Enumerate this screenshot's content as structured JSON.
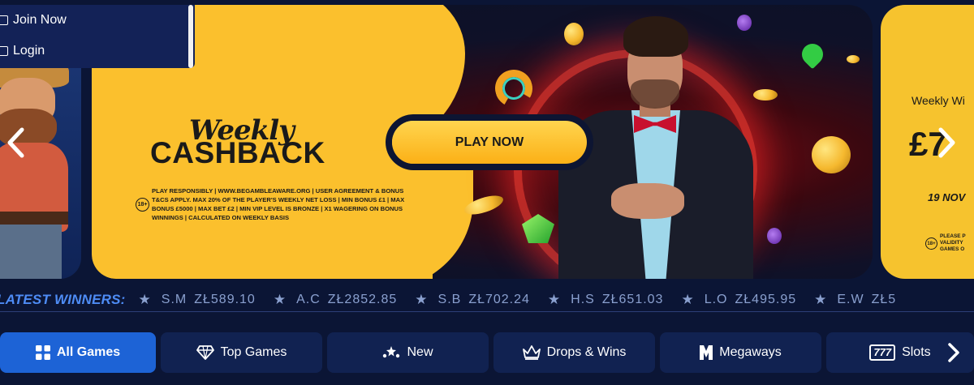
{
  "menu": {
    "items": [
      {
        "label": "Join Now"
      },
      {
        "label": "Login"
      }
    ]
  },
  "hero": {
    "title_line1": "Weekly",
    "title_line2": "CASHBACK",
    "age_badge": "18+",
    "disclaimer": "PLAY RESPONSIBLY | WWW.BEGAMBLEAWARE.ORG | USER AGREEMENT & BONUS T&CS APPLY. MAX 20% OF THE PLAYER'S WEEKLY NET LOSS | MIN BONUS £1 | MAX BONUS £5000 | MAX BET £2 | MIN VIP LEVEL IS BRONZE | X1 WAGERING ON BONUS WINNINGS | CALCULATED ON WEEKLY BASIS",
    "cta_label": "PLAY NOW"
  },
  "next_slide": {
    "text1": "Weekly Wi",
    "text2": "£7",
    "text3": "19 NOV",
    "age_badge": "18+",
    "disclaimer": "PLEASE P\nVALIDITY\nGAMES O"
  },
  "winners": {
    "title": "LATEST WINNERS:",
    "items": [
      {
        "name": "S.M",
        "amount": "ZŁ589.10"
      },
      {
        "name": "A.C",
        "amount": "ZŁ2852.85"
      },
      {
        "name": "S.B",
        "amount": "ZŁ702.24"
      },
      {
        "name": "H.S",
        "amount": "ZŁ651.03"
      },
      {
        "name": "L.O",
        "amount": "ZŁ495.95"
      },
      {
        "name": "E.W",
        "amount": "ZŁ5"
      }
    ]
  },
  "tabs": [
    {
      "label": "All Games",
      "icon": "grid-icon",
      "active": true
    },
    {
      "label": "Top Games",
      "icon": "diamond-icon"
    },
    {
      "label": "New",
      "icon": "sparkle-icon"
    },
    {
      "label": "Drops & Wins",
      "icon": "crown-icon"
    },
    {
      "label": "Megaways",
      "icon": "megaways-icon"
    },
    {
      "label": "Slots",
      "icon": "slots-777-icon",
      "icon_text": "777"
    }
  ],
  "colors": {
    "background": "#0b1535",
    "active_tab": "#1d63d6",
    "tab": "#112251",
    "cta_yellow": "#fbc02d",
    "winners_title": "#4e8cf5"
  }
}
